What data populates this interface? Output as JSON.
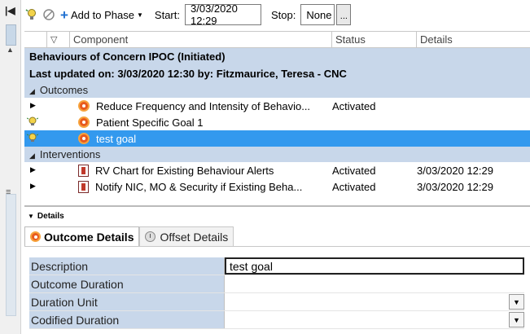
{
  "toolbar": {
    "add_to_phase_label": "Add to Phase",
    "start_label": "Start:",
    "start_value": "3/03/2020 12:29",
    "stop_label": "Stop:",
    "stop_value": "None",
    "ellipsis": "..."
  },
  "grid": {
    "columns": [
      "Component",
      "Status",
      "Details"
    ],
    "plan_title": "Behaviours of Concern IPOC (Initiated)",
    "last_updated": "Last updated on: 3/03/2020 12:30   by: Fitzmaurice, Teresa  - CNC",
    "sections": [
      {
        "label": "Outcomes",
        "rows": [
          {
            "component": "Reduce Frequency and Intensity of Behavio...",
            "status": "Activated",
            "details": ""
          },
          {
            "component": "Patient Specific Goal 1",
            "status": "",
            "details": ""
          },
          {
            "component": "test goal",
            "status": "",
            "details": ""
          }
        ]
      },
      {
        "label": "Interventions",
        "rows": [
          {
            "component": "RV Chart for Existing Behaviour Alerts",
            "status": "Activated",
            "details": "3/03/2020 12:29"
          },
          {
            "component": "Notify NIC, MO & Security  if Existing Beha...",
            "status": "Activated",
            "details": "3/03/2020 12:29"
          }
        ]
      }
    ]
  },
  "details": {
    "header": "Details",
    "tabs": [
      "Outcome Details",
      "Offset Details"
    ],
    "fields": [
      {
        "label": "Description",
        "value": "test goal"
      },
      {
        "label": "Outcome Duration",
        "value": ""
      },
      {
        "label": "Duration Unit",
        "value": ""
      },
      {
        "label": "Codified Duration",
        "value": ""
      }
    ]
  },
  "colors": {
    "selection": "#3399ee",
    "group_band": "#c8d7ea",
    "accent_plus": "#1e6fd0"
  }
}
